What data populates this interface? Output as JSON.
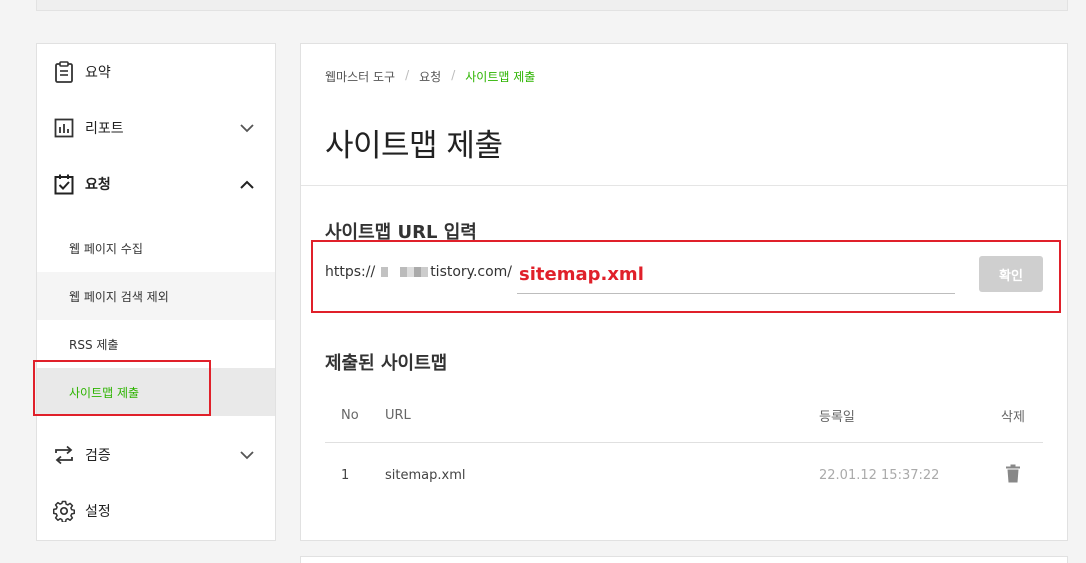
{
  "sidebar": {
    "items": [
      {
        "label": "요약"
      },
      {
        "label": "리포트"
      },
      {
        "label": "요청"
      },
      {
        "label": "검증"
      },
      {
        "label": "설정"
      }
    ],
    "sub_items": [
      {
        "label": "웹 페이지 수집"
      },
      {
        "label": "웹 페이지 검색 제외"
      },
      {
        "label": "RSS 제출"
      },
      {
        "label": "사이트맵 제출"
      }
    ]
  },
  "breadcrumb": {
    "root": "웹마스터 도구",
    "parent": "요청",
    "current": "사이트맵 제출",
    "separator": "/"
  },
  "page_title": "사이트맵 제출",
  "url_section": {
    "title": "사이트맵 URL 입력",
    "prefix_start": "https://",
    "prefix_end": "tistory.com/",
    "input_value": "sitemap.xml",
    "confirm_label": "확인"
  },
  "submitted_section": {
    "title": "제출된 사이트맵",
    "columns": {
      "no": "No",
      "url": "URL",
      "date": "등록일",
      "delete": "삭제"
    },
    "rows": [
      {
        "no": "1",
        "url": "sitemap.xml",
        "date": "22.01.12 15:37:22"
      }
    ]
  },
  "colors": {
    "accent_green": "#2db400",
    "highlight_red": "#e0202a",
    "button_disabled": "#cfcfcf"
  }
}
